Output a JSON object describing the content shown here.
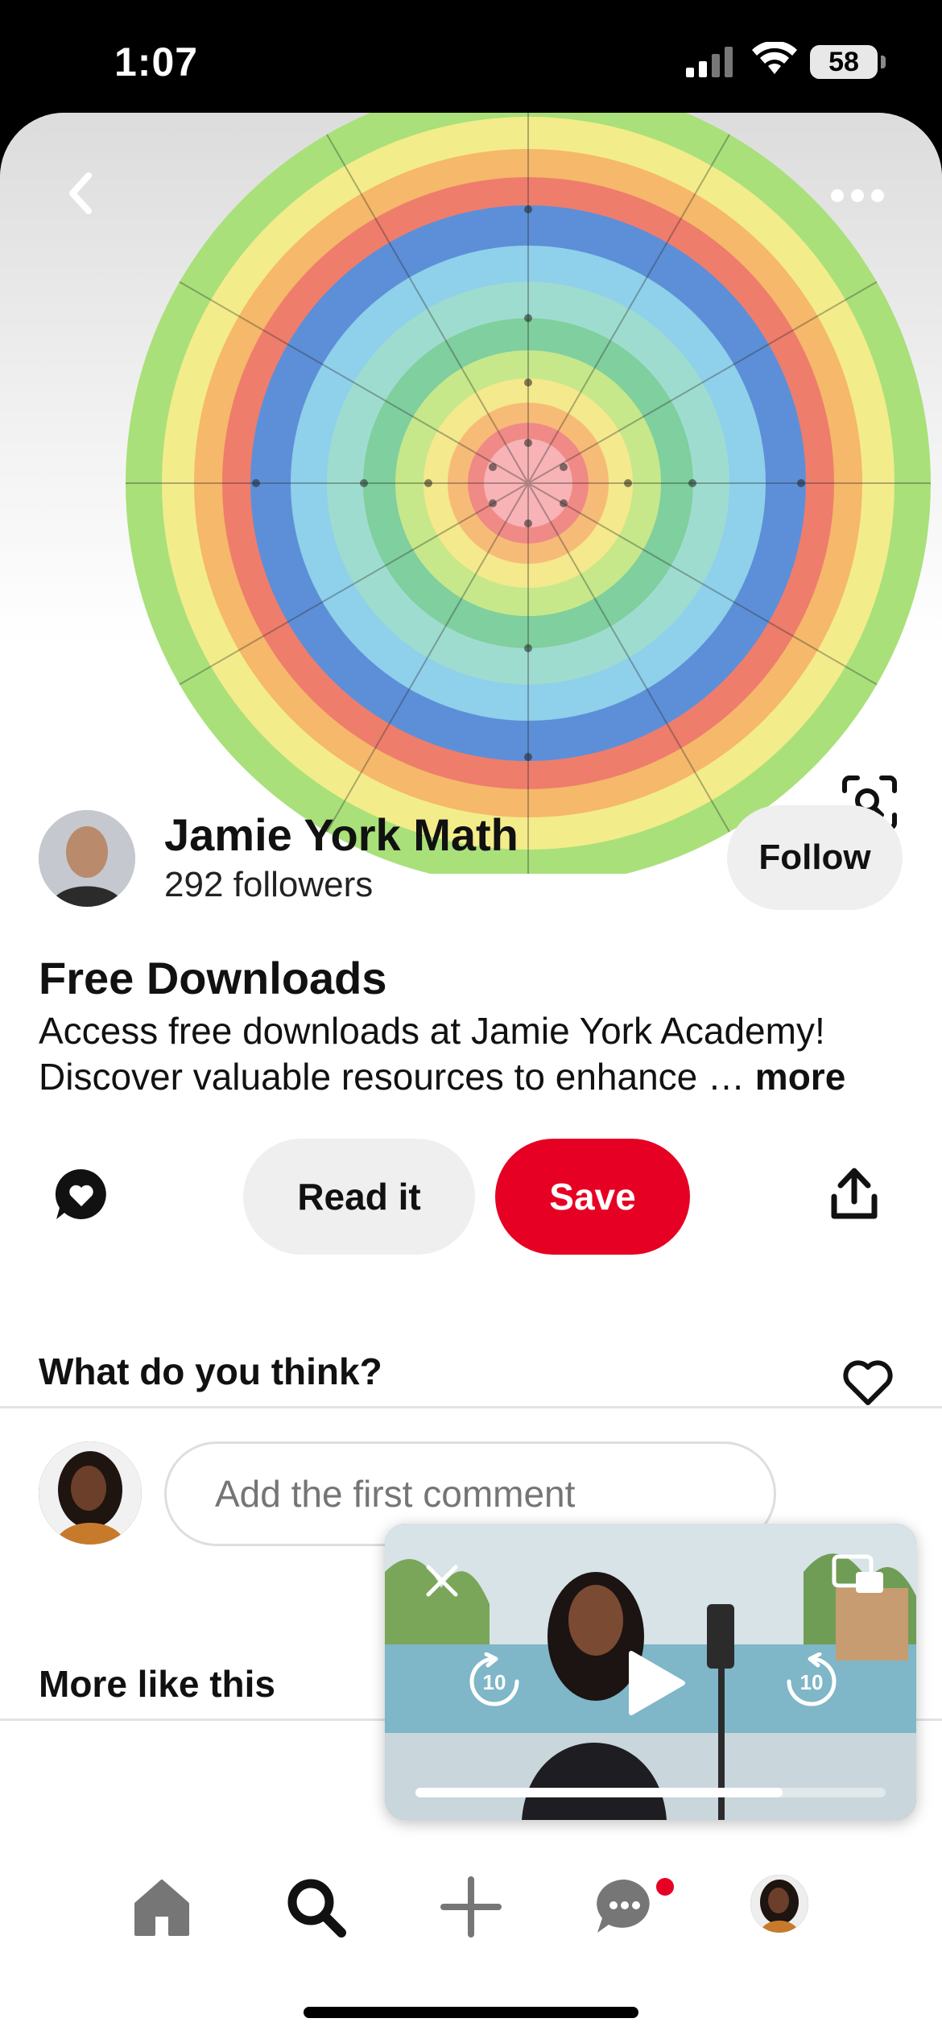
{
  "status_bar": {
    "time": "1:07",
    "battery": "58"
  },
  "profile": {
    "name": "Jamie York Math",
    "followers": "292 followers",
    "follow_label": "Follow"
  },
  "pin": {
    "title": "Free Downloads",
    "description": "Access free downloads at Jamie York Academy! Discover valuable resources to enhance … ",
    "more_label": "more"
  },
  "actions": {
    "read_label": "Read it",
    "save_label": "Save"
  },
  "comments": {
    "heading": "What do you think?",
    "placeholder": "Add the first comment"
  },
  "more_like_this": "More like this",
  "mini_player": {
    "progress": 0.78,
    "skip_seconds": "10"
  },
  "nav": {
    "items": [
      "home-icon",
      "search-icon",
      "add-icon",
      "messages-icon",
      "profile"
    ],
    "active": "search"
  },
  "colors": {
    "accent": "#e60023",
    "pill": "#efefef"
  }
}
